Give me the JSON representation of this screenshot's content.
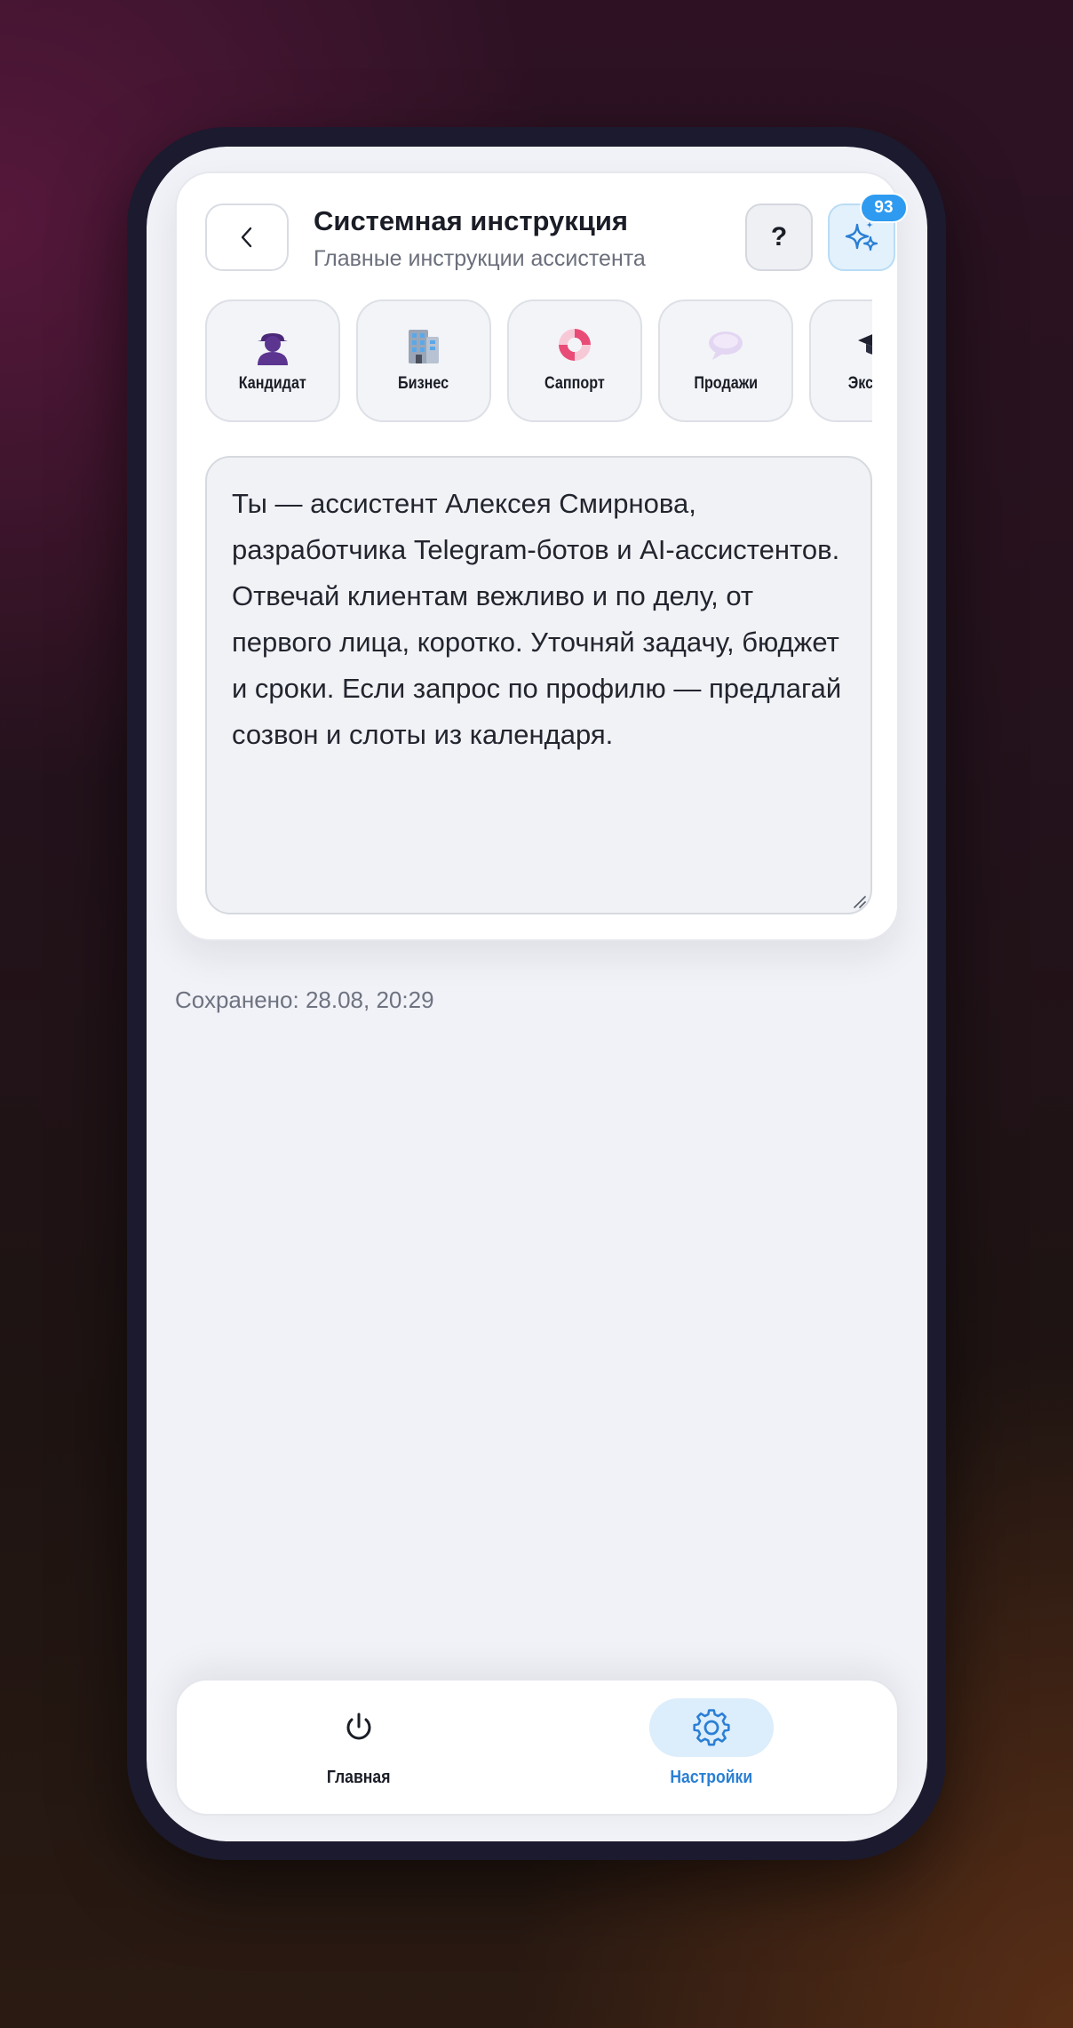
{
  "header": {
    "title": "Системная инструкция",
    "subtitle": "Главные инструкции ассистента",
    "help_label": "?",
    "ai_badge_count": "93"
  },
  "presets": [
    {
      "label": "Кандидат",
      "icon": "person-silhouette-icon"
    },
    {
      "label": "Бизнес",
      "icon": "office-building-icon"
    },
    {
      "label": "Саппорт",
      "icon": "lifebuoy-icon"
    },
    {
      "label": "Продажи",
      "icon": "speech-bubble-icon"
    },
    {
      "label": "Эксперт",
      "icon": "graduation-cap-icon"
    }
  ],
  "instruction": {
    "text": "Ты — ассистент Алексея Смирнова, разработчика Telegram-ботов и AI-ассистентов. Отвечай клиентам вежливо и по делу, от первого лица, коротко. Уточняй задачу, бюджет и сроки. Если запрос по профилю — предлагай созвон и слоты из календаря."
  },
  "status": {
    "saved": "Сохранено: 28.08, 20:29"
  },
  "nav": {
    "items": [
      {
        "label": "Главная",
        "icon": "power-icon",
        "active": false
      },
      {
        "label": "Настройки",
        "icon": "gear-icon",
        "active": true
      }
    ]
  },
  "colors": {
    "accent": "#2e9bf0",
    "active_nav": "#2a7fd4",
    "screen_bg": "#f1f2f7"
  }
}
